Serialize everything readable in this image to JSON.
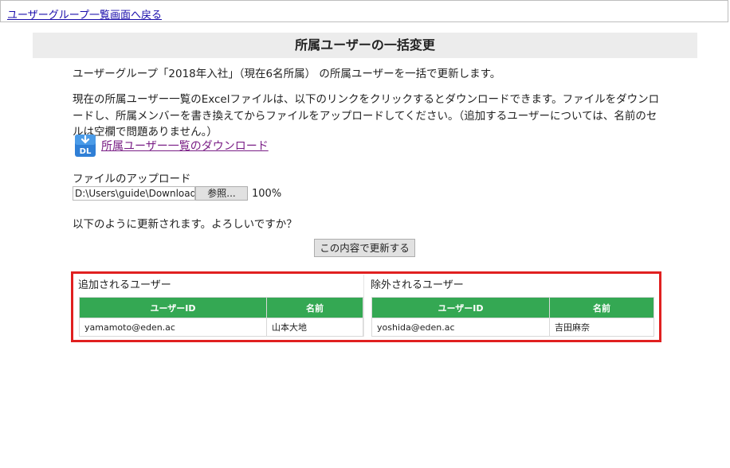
{
  "nav": {
    "back_link": "ユーザーグループ一覧画面へ戻る"
  },
  "page": {
    "title": "所属ユーザーの一括変更"
  },
  "intro": {
    "line1": "ユーザーグループ「2018年入社」（現在6名所属） の所属ユーザーを一括で更新します。",
    "line2": "現在の所属ユーザー一覧のExcelファイルは、以下のリンクをクリックするとダウンロードできます。ファイルをダウンロードし、所属メンバーを書き換えてからファイルをアップロードしてください。（追加するユーザーについては、名前のセルは空欄で問題ありません。）"
  },
  "download": {
    "icon_text": "DL",
    "link_label": "所属ユーザー一覧のダウンロード"
  },
  "upload": {
    "label": "ファイルのアップロード",
    "file_value": "D:\\Users\\guide\\Download",
    "browse_label": "参照...",
    "progress": "100%"
  },
  "confirm": {
    "message": "以下のように更新されます。よろしいですか？",
    "button_label": "この内容で更新する"
  },
  "added": {
    "title": "追加されるユーザー",
    "columns": [
      "ユーザーID",
      "名前"
    ],
    "rows": [
      {
        "id": "yamamoto@eden.ac",
        "name": "山本大地"
      }
    ]
  },
  "removed": {
    "title": "除外されるユーザー",
    "columns": [
      "ユーザーID",
      "名前"
    ],
    "rows": [
      {
        "id": "yoshida@eden.ac",
        "name": "吉田麻奈"
      }
    ]
  },
  "colors": {
    "header_green": "#34a853",
    "highlight_red": "#e02020",
    "link_visited": "#7a1f86",
    "link": "#1a0dab"
  }
}
